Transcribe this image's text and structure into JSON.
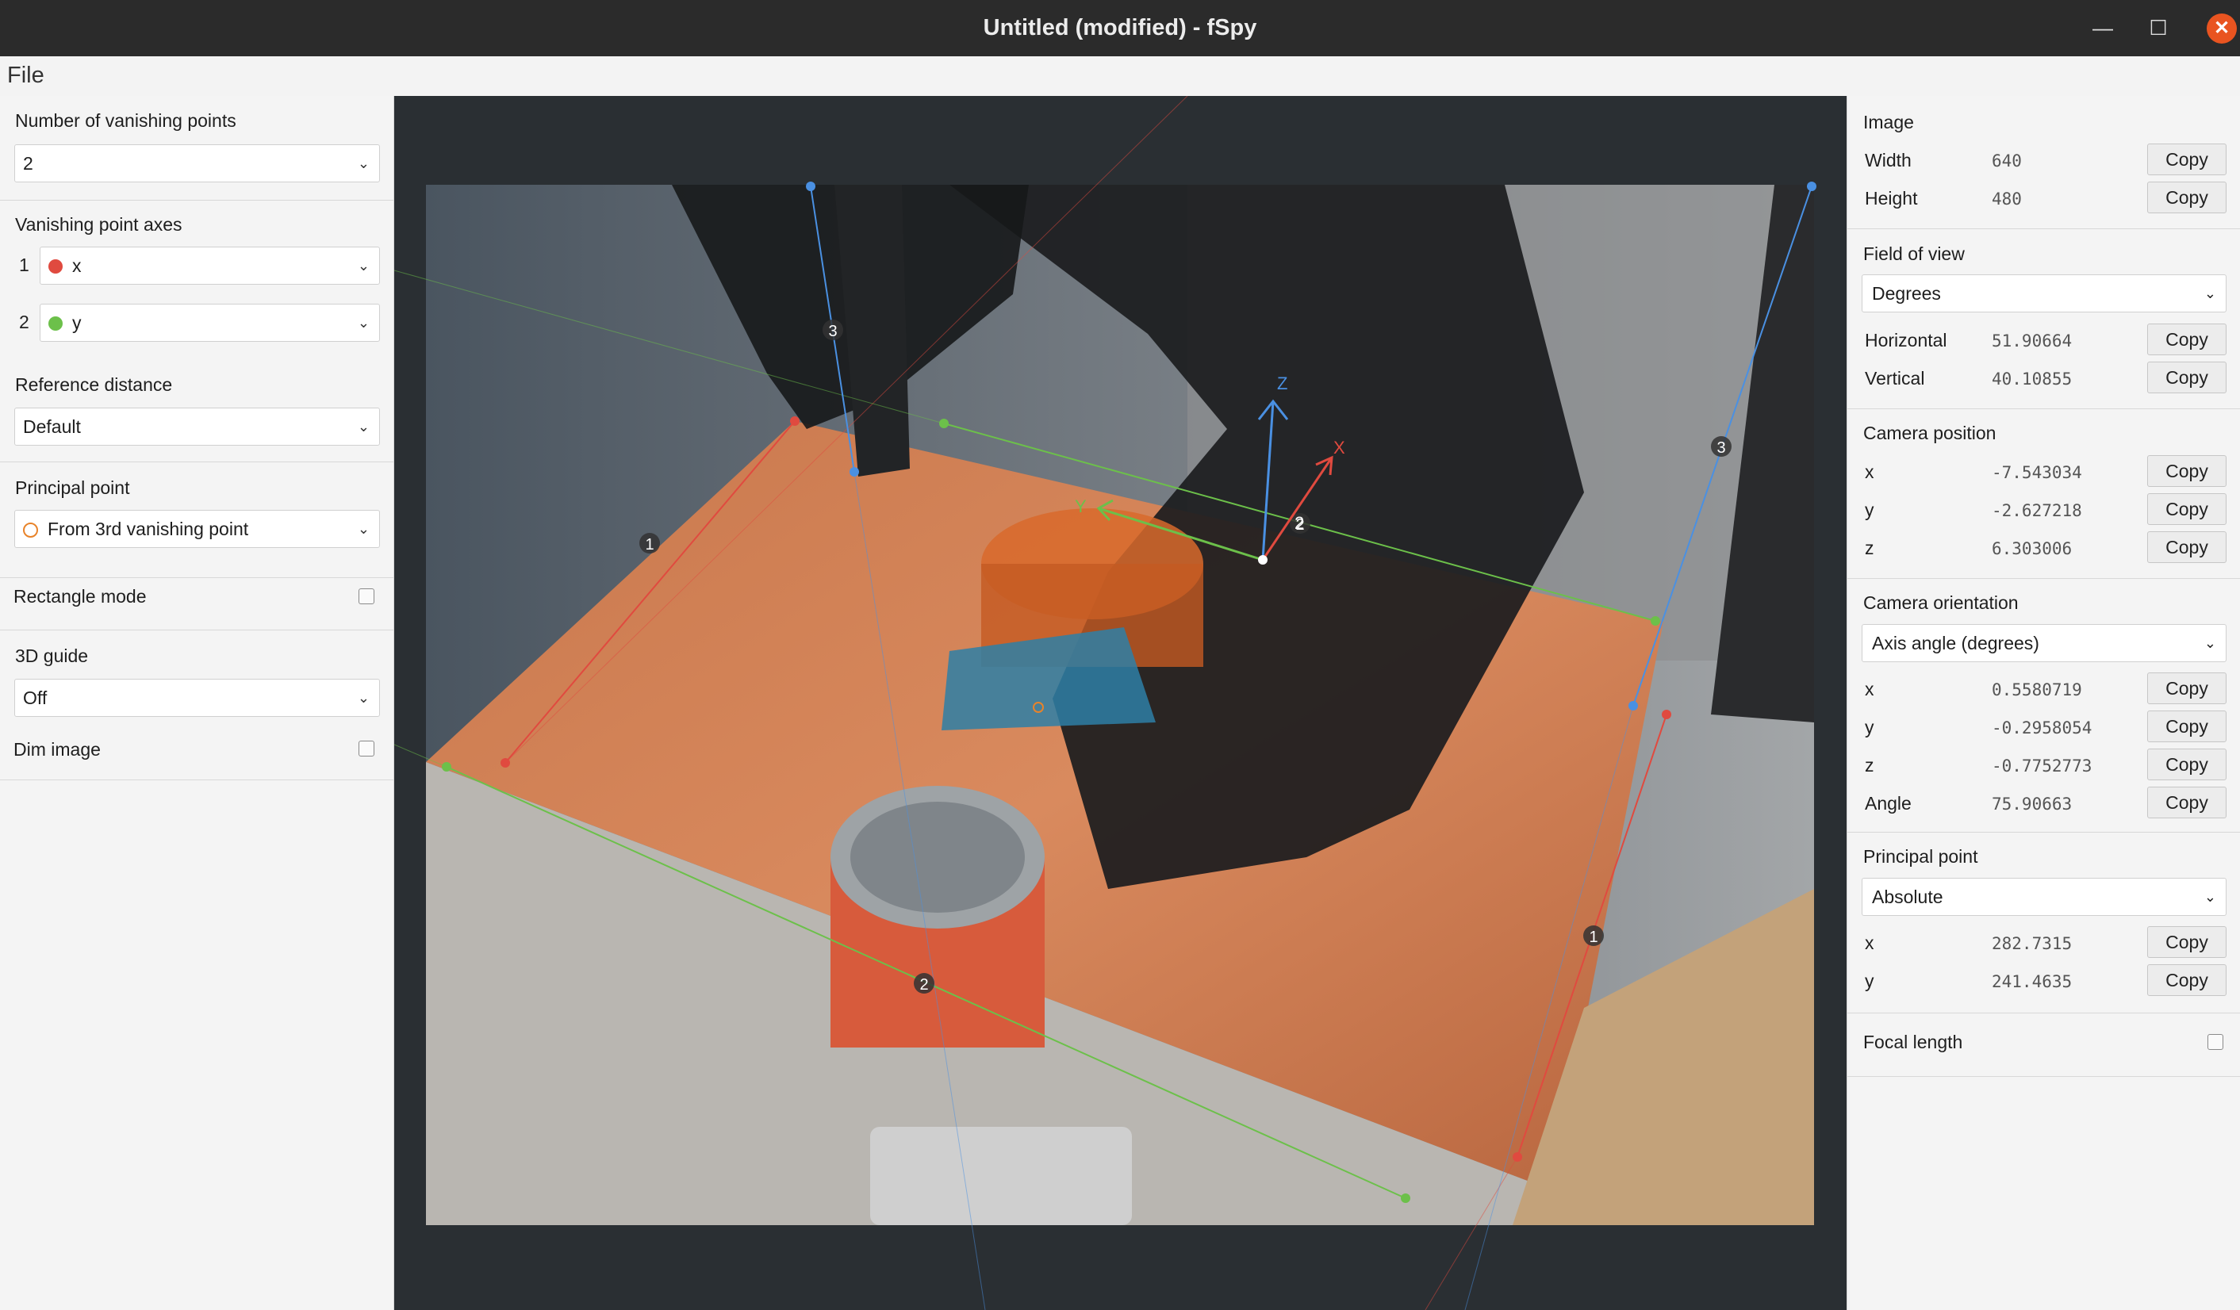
{
  "window": {
    "title": "Untitled (modified) - fSpy",
    "minimize": "—",
    "maximize": "☐",
    "close": "✕"
  },
  "menu": {
    "file": "File"
  },
  "left": {
    "num_vp_label": "Number of vanishing points",
    "num_vp_value": "2",
    "vp_axes_label": "Vanishing point axes",
    "vp1_index": "1",
    "vp1_axis": "x",
    "vp2_index": "2",
    "vp2_axis": "y",
    "ref_dist_label": "Reference distance",
    "ref_dist_value": "Default",
    "pp_label": "Principal point",
    "pp_value": "From 3rd vanishing point",
    "rect_mode_label": "Rectangle mode",
    "guide_label": "3D guide",
    "guide_value": "Off",
    "dim_label": "Dim image"
  },
  "right": {
    "image": {
      "heading": "Image",
      "width_label": "Width",
      "width": "640",
      "height_label": "Height",
      "height": "480"
    },
    "fov": {
      "heading": "Field of view",
      "unit": "Degrees",
      "h_label": "Horizontal",
      "h": "51.90664",
      "v_label": "Vertical",
      "v": "40.10855"
    },
    "cam_pos": {
      "heading": "Camera position",
      "x_label": "x",
      "x": "-7.543034",
      "y_label": "y",
      "y": "-2.627218",
      "z_label": "z",
      "z": "6.303006"
    },
    "cam_orient": {
      "heading": "Camera orientation",
      "mode": "Axis angle (degrees)",
      "x_label": "x",
      "x": "0.5580719",
      "y_label": "y",
      "y": "-0.2958054",
      "z_label": "z",
      "z": "-0.7752773",
      "angle_label": "Angle",
      "angle": "75.90663"
    },
    "pp": {
      "heading": "Principal point",
      "mode": "Absolute",
      "x_label": "x",
      "x": "282.7315",
      "y_label": "y",
      "y": "241.4635"
    },
    "focal_label": "Focal length",
    "copy_label": "Copy"
  },
  "viewport": {
    "handle_labels": [
      "1",
      "1",
      "2",
      "2",
      "3",
      "3"
    ],
    "axis_labels": {
      "x": "X",
      "y": "Y",
      "z": "Z"
    },
    "origin_label": "2"
  },
  "colors": {
    "x_axis": "#e04a3f",
    "y_axis": "#6cc04a",
    "z_axis": "#4a90e2",
    "accent": "#e95420"
  }
}
